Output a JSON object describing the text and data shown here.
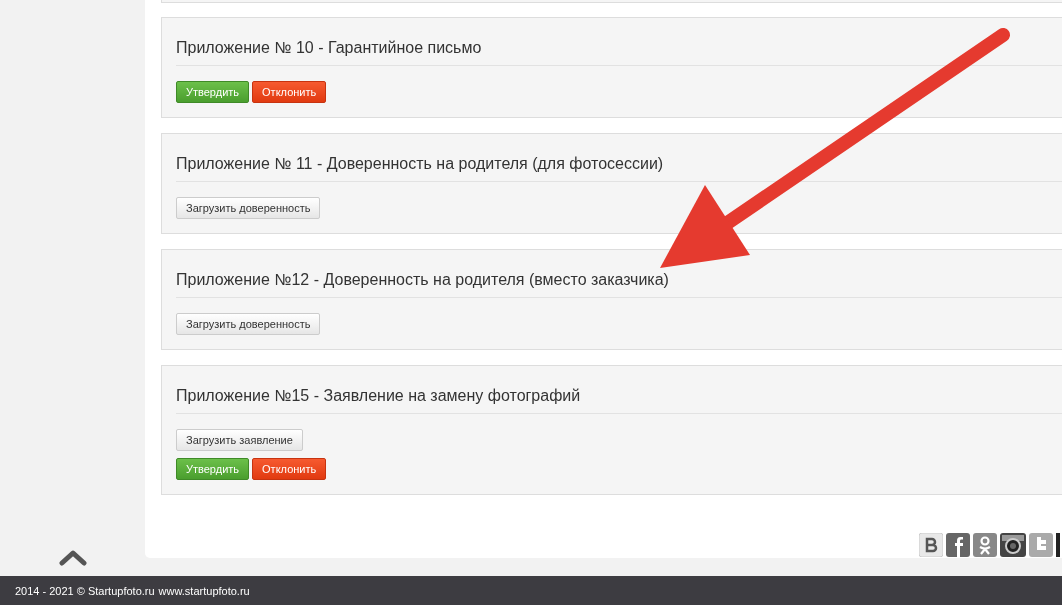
{
  "panels": [
    {
      "title": "Приложение № 10 - Гарантийное письмо",
      "button_rows": [
        [
          {
            "kind": "approve",
            "label": "Утвердить"
          },
          {
            "kind": "reject",
            "label": "Отклонить"
          }
        ]
      ]
    },
    {
      "title": "Приложение № 11 - Доверенность на родителя (для фотосессии)",
      "button_rows": [
        [
          {
            "kind": "upload",
            "label": "Загрузить доверенность"
          }
        ]
      ]
    },
    {
      "title": "Приложение №12 - Доверенность на родителя (вместо заказчика)",
      "button_rows": [
        [
          {
            "kind": "upload",
            "label": "Загрузить доверенность"
          }
        ]
      ]
    },
    {
      "title": "Приложение №15 - Заявление на замену фотографий",
      "button_rows": [
        [
          {
            "kind": "upload",
            "label": "Загрузить заявление"
          }
        ],
        [
          {
            "kind": "approve",
            "label": "Утвердить"
          },
          {
            "kind": "reject",
            "label": "Отклонить"
          }
        ]
      ]
    }
  ],
  "footer": {
    "copyright": "2014 - 2021 © Startupfoto.ru",
    "link": "www.startupfoto.ru"
  }
}
